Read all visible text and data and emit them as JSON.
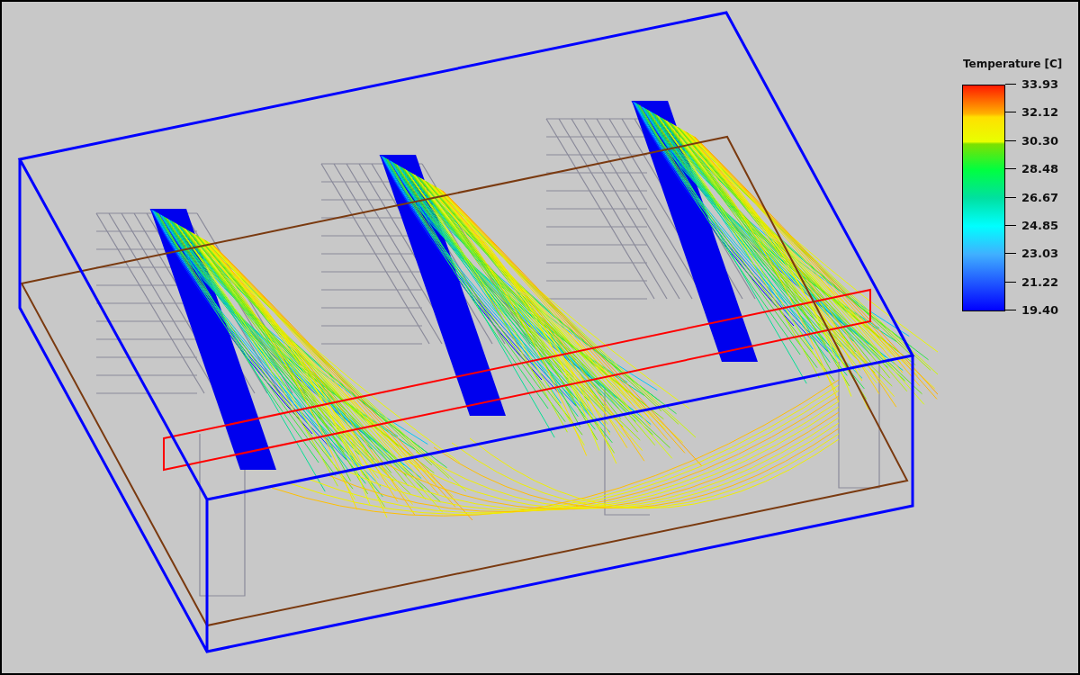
{
  "legend": {
    "title": "Temperature [C]",
    "ticks": [
      "33.93",
      "32.12",
      "30.30",
      "28.48",
      "26.67",
      "24.85",
      "23.03",
      "21.22",
      "19.40"
    ]
  }
}
